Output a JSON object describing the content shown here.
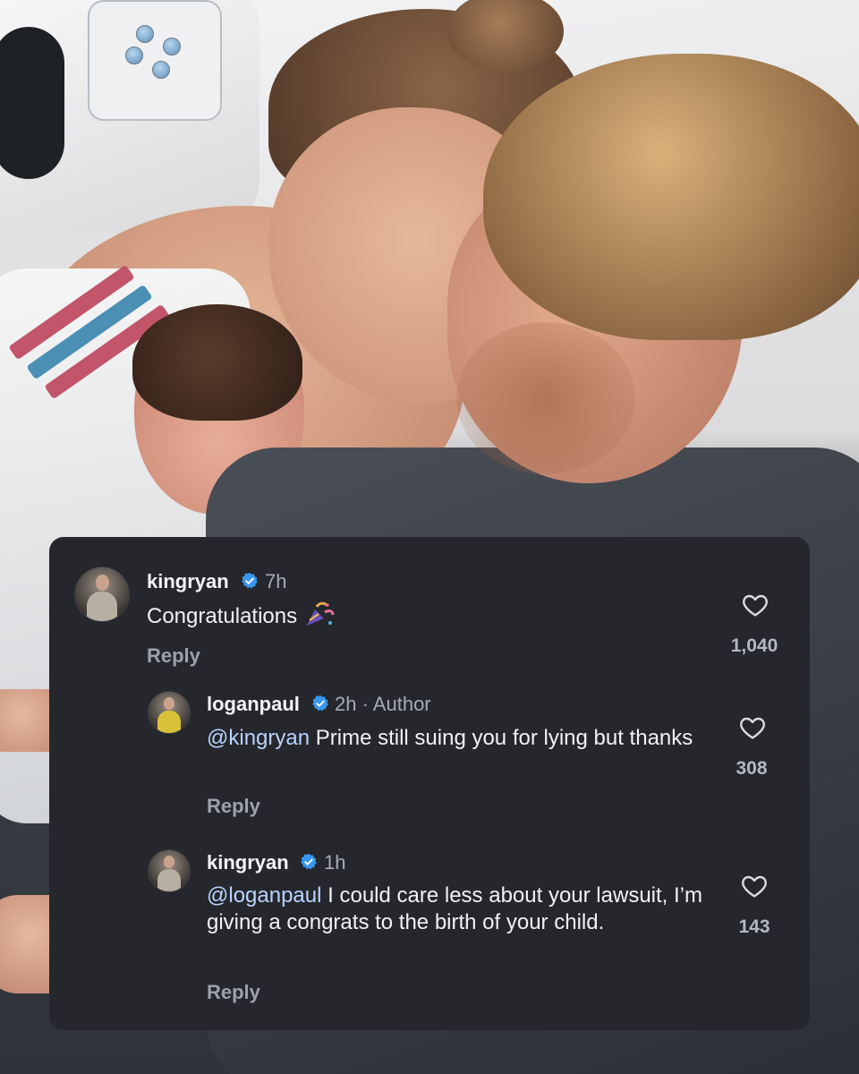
{
  "comments": [
    {
      "username": "kingryan",
      "time": "7h",
      "text": "Congratulations",
      "emoji_icon": "party-popper-emoji",
      "reply_label": "Reply",
      "likes": "1,040"
    },
    {
      "username": "loganpaul",
      "time": "2h · Author",
      "mention": "@kingryan",
      "text": " Prime still suing you for lying but thanks",
      "reply_label": "Reply",
      "likes": "308"
    },
    {
      "username": "kingryan",
      "time": "1h",
      "mention": "@loganpaul",
      "text": " I could care less about your lawsuit, I’m giving a congrats to the birth of your child.",
      "reply_label": "Reply",
      "likes": "143"
    }
  ],
  "colors": {
    "card_bg": "#25272c",
    "verified": "#3897f0",
    "mention": "#b9d3ff",
    "muted": "#a7abb3"
  }
}
